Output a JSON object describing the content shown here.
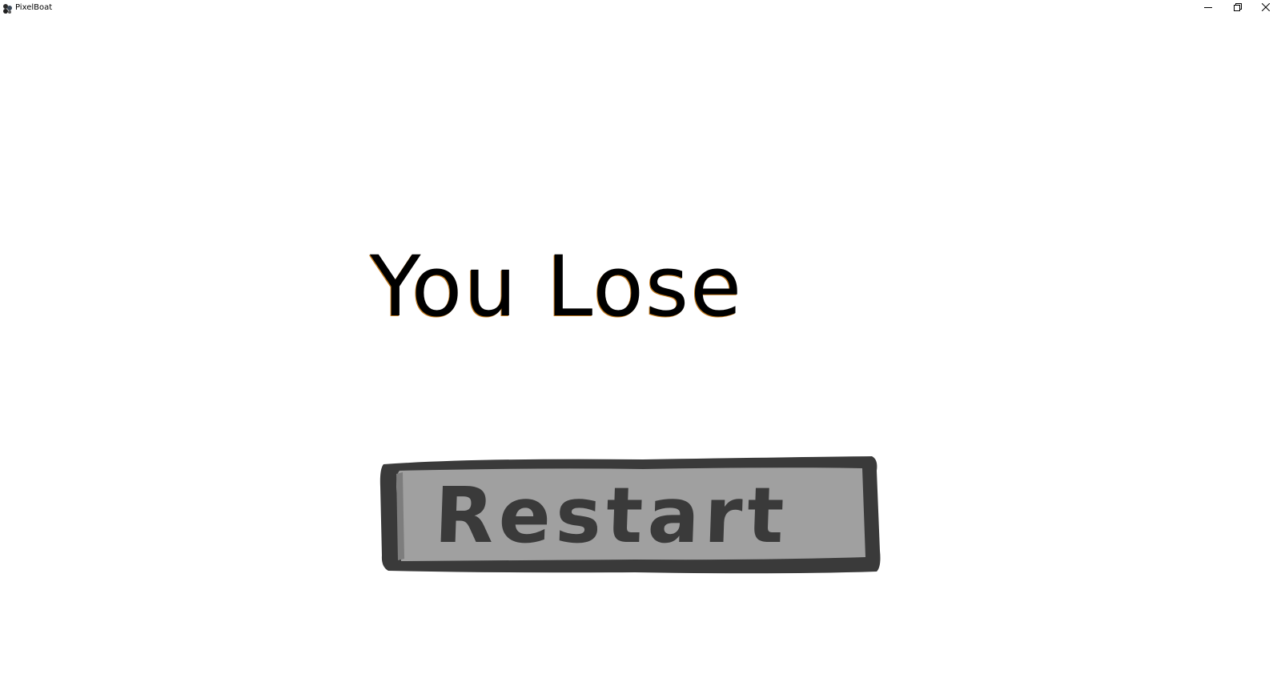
{
  "window": {
    "title": "PixelBoat",
    "icon": "pixelboat-app-icon",
    "controls": {
      "minimize_icon": "minimize-icon",
      "restore_icon": "restore-icon",
      "close_icon": "close-icon"
    }
  },
  "game": {
    "message": "You Lose",
    "restart_label": "Restart"
  },
  "colors": {
    "background": "#ffffff",
    "message_text": "#000000",
    "button_fill": "#a0a0a0",
    "button_border": "#3a3a3a"
  }
}
